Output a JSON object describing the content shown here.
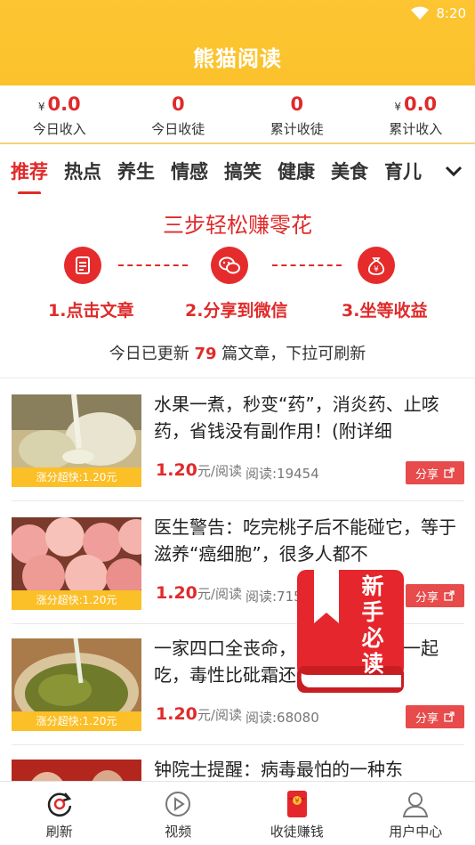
{
  "status": {
    "time": "8:20"
  },
  "app_title": "熊猫阅读",
  "stats": [
    {
      "value": "0.0",
      "currency": "¥",
      "label": "今日收入"
    },
    {
      "value": "0",
      "currency": "",
      "label": "今日收徒"
    },
    {
      "value": "0",
      "currency": "",
      "label": "累计收徒"
    },
    {
      "value": "0.0",
      "currency": "¥",
      "label": "累计收入"
    }
  ],
  "categories": [
    "推荐",
    "热点",
    "养生",
    "情感",
    "搞笑",
    "健康",
    "美食",
    "育儿"
  ],
  "steps": {
    "title": "三步轻松赚零花",
    "labels": [
      "1.点击文章",
      "2.分享到微信",
      "3.坐等收益"
    ]
  },
  "update_notice": {
    "prefix": "今日已更新",
    "count": "79",
    "suffix": "篇文章，下拉可刷新"
  },
  "articles": [
    {
      "title": "水果一煮，秒变“药”，消炎药、止咳药，省钱没有副作用！(附详细",
      "badge": "涨分超快:1.20元",
      "price": "1.20",
      "unit": "元/阅读",
      "reads": "阅读:19454",
      "share": "分享"
    },
    {
      "title": "医生警告：吃完桃子后不能碰它，等于滋养“癌细胞”，很多人都不",
      "badge": "涨分超快:1.20元",
      "price": "1.20",
      "unit": "元/阅读",
      "reads": "阅读:715",
      "share": "分享"
    },
    {
      "title": "一家四口全丧命，这些不能和它一起吃，毒性比砒霜还强的！",
      "badge": "涨分超快:1.20元",
      "price": "1.20",
      "unit": "元/阅读",
      "reads": "阅读:68080",
      "share": "分享"
    },
    {
      "title": "钟院士提醒：病毒最怕的一种东",
      "badge": "",
      "price": "",
      "unit": "",
      "reads": "",
      "share": ""
    }
  ],
  "guide": {
    "text": "新手必读"
  },
  "bottom_nav": [
    {
      "label": "刷新",
      "icon": "refresh-icon"
    },
    {
      "label": "视频",
      "icon": "play-icon"
    },
    {
      "label": "收徒赚钱",
      "icon": "red-envelope-icon"
    },
    {
      "label": "用户中心",
      "icon": "user-icon"
    }
  ],
  "colors": {
    "brand_yellow": "#fbc22c",
    "accent_red": "#e02a2a"
  }
}
